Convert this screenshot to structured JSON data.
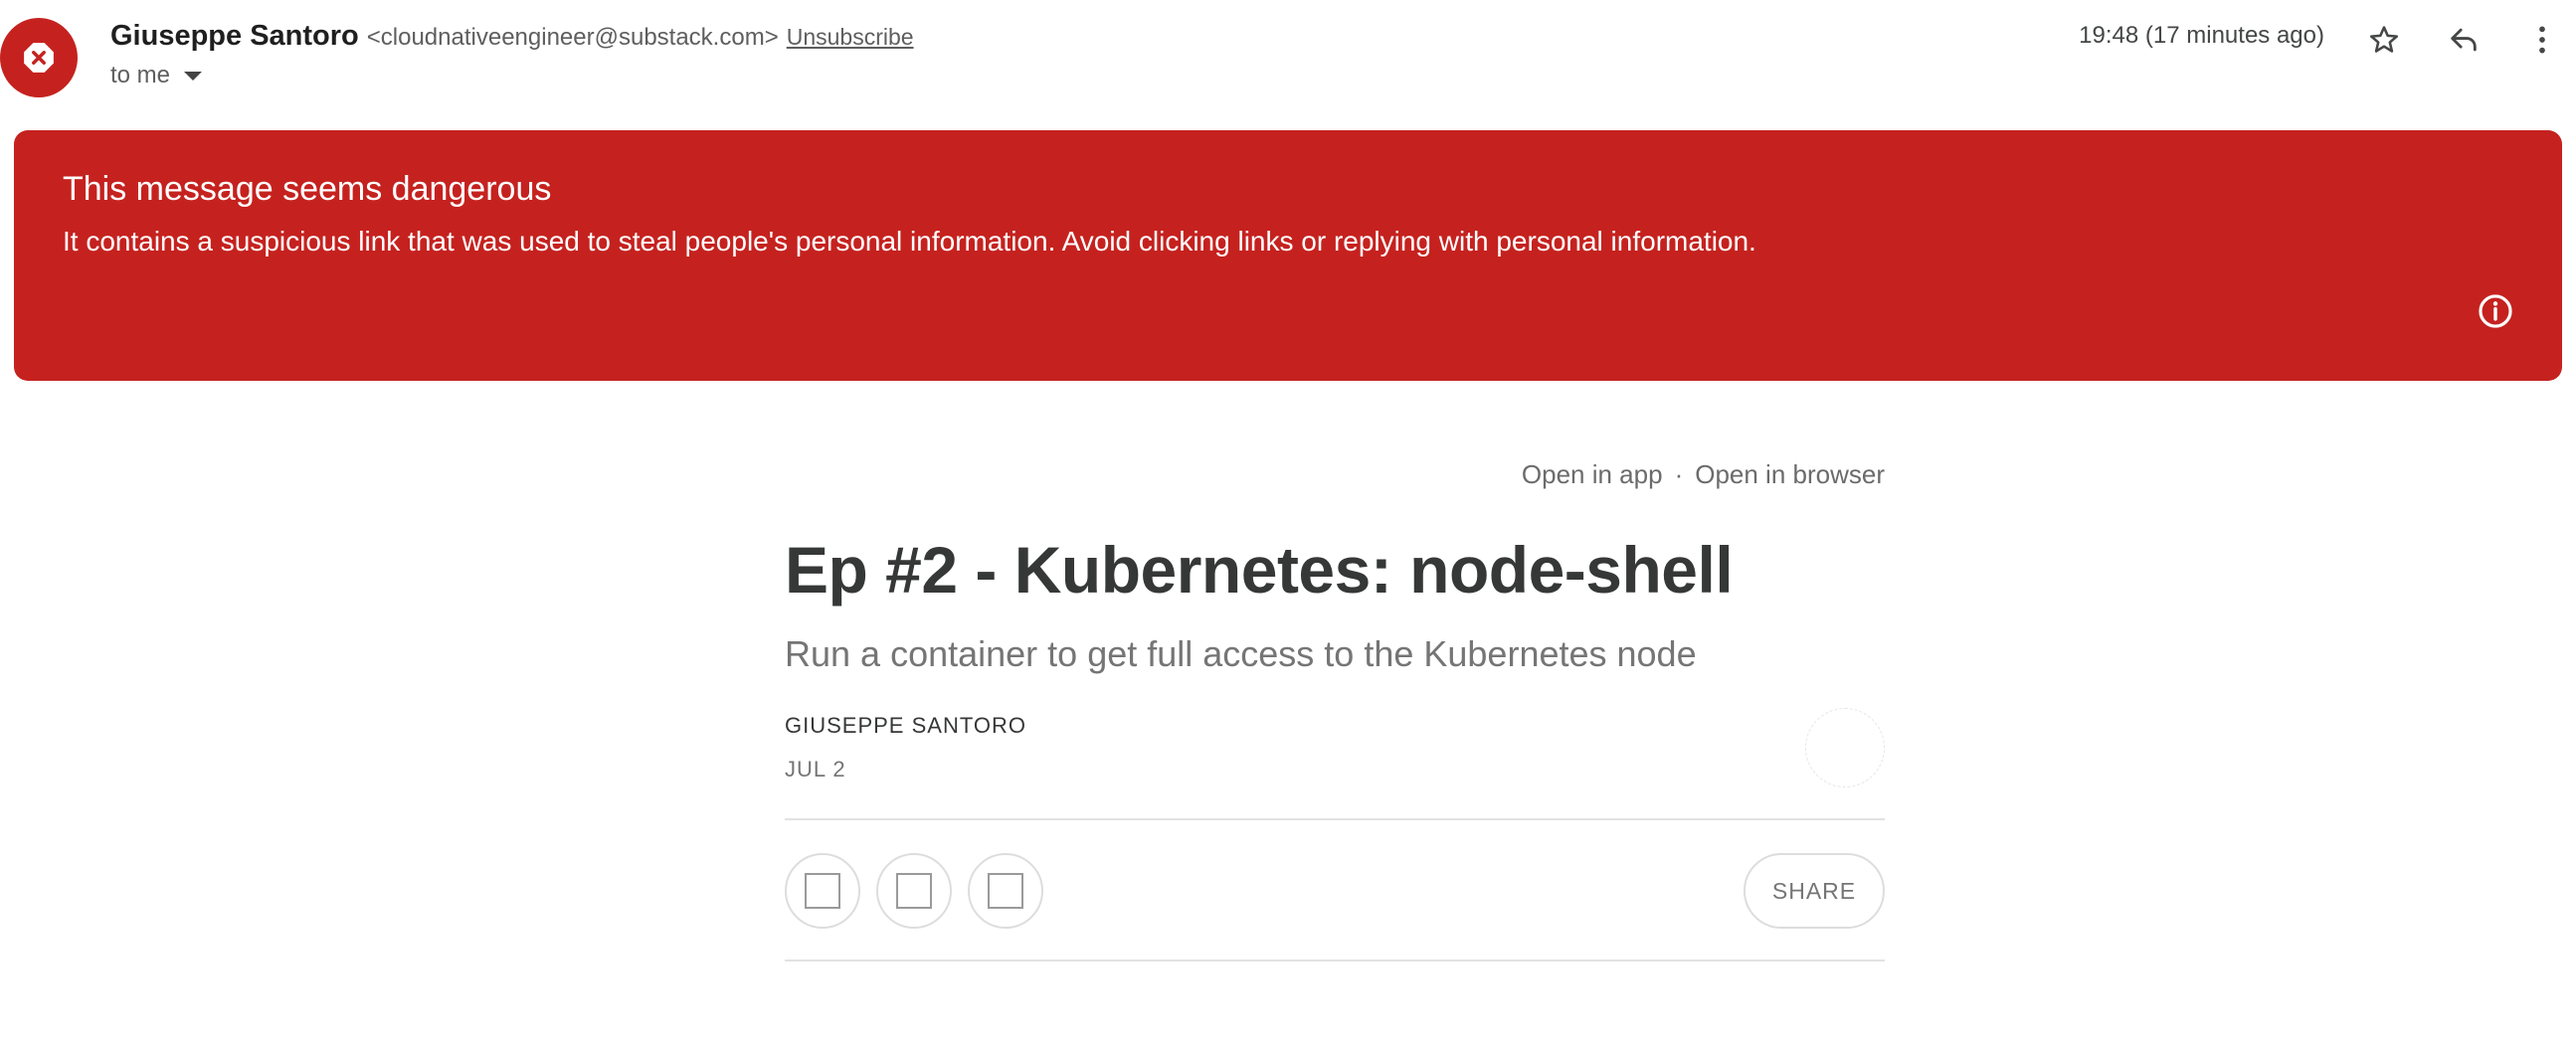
{
  "header": {
    "sender_name": "Giuseppe Santoro",
    "sender_email": "<cloudnativeengineer@substack.com>",
    "unsubscribe_label": "Unsubscribe",
    "recipient_label": "to me",
    "timestamp": "19:48 (17 minutes ago)",
    "avatar_icon": "blocked-x-icon",
    "avatar_color": "#c5221f",
    "actions": [
      "star-icon",
      "reply-icon",
      "more-vert-icon"
    ]
  },
  "warning": {
    "title": "This message seems dangerous",
    "message": "It contains a suspicious link that was used to steal people's personal information. Avoid clicking links or replying with personal information.",
    "icon": "info-icon",
    "background_color": "#c5221f"
  },
  "newsletter": {
    "open_in_app": "Open in app",
    "separator": "·",
    "open_in_browser": "Open in browser",
    "title": "Ep #2 - Kubernetes: node-shell",
    "subtitle": "Run a container to get full access to the Kubernetes node",
    "author": "GIUSEPPE SANTORO",
    "date": "JUL 2",
    "share_label": "SHARE"
  }
}
